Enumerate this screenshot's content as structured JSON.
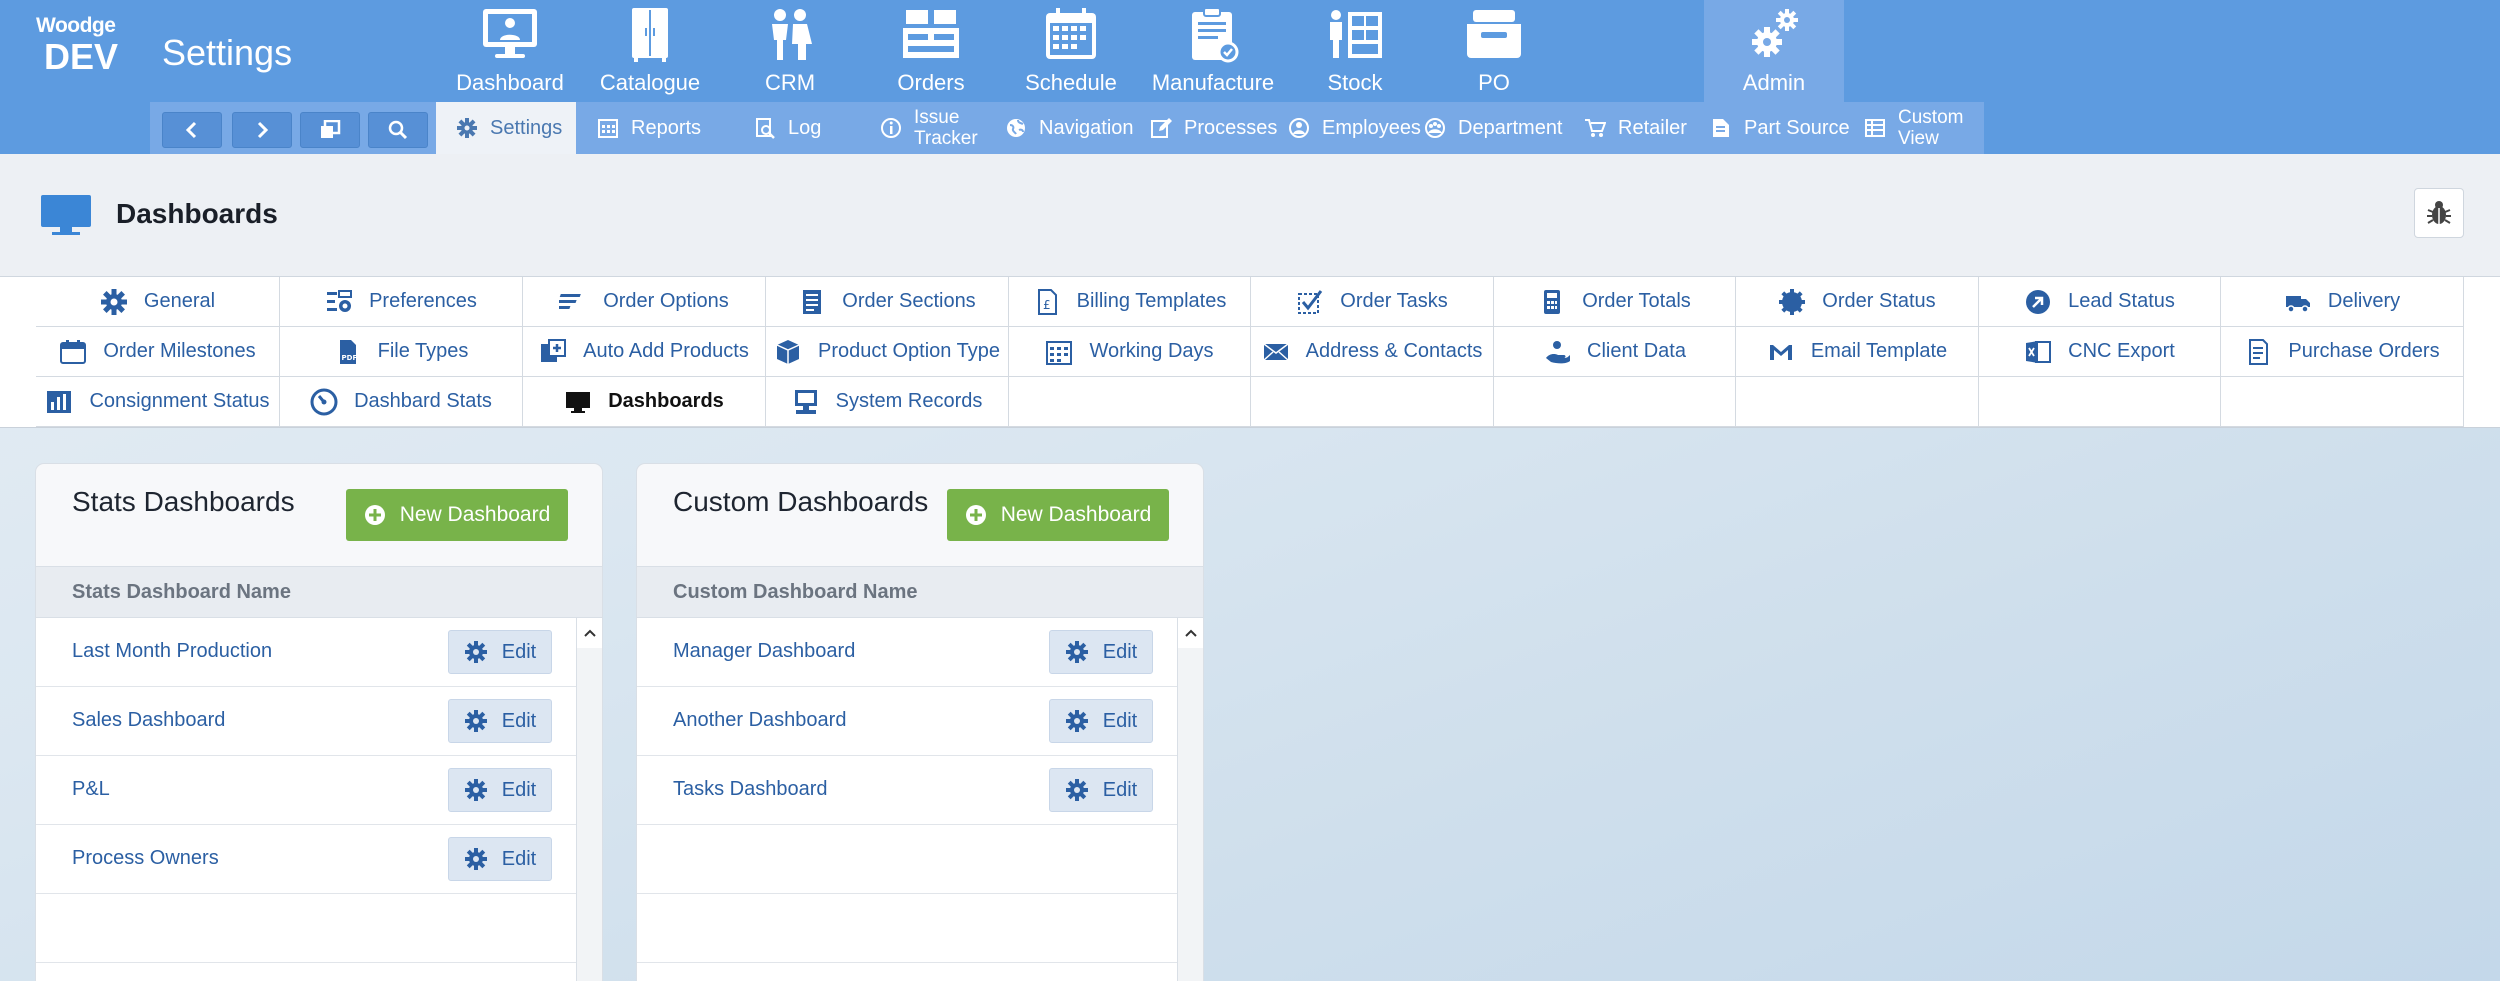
{
  "app": {
    "brand": "Woodge",
    "env": "DEV",
    "title": "Settings"
  },
  "modules": [
    {
      "label": "Dashboard",
      "icon": "monitor-person-icon"
    },
    {
      "label": "Catalogue",
      "icon": "wardrobe-icon"
    },
    {
      "label": "CRM",
      "icon": "people-icon"
    },
    {
      "label": "Orders",
      "icon": "orders-icon"
    },
    {
      "label": "Schedule",
      "icon": "calendar-icon"
    },
    {
      "label": "Manufacture",
      "icon": "clipboard-icon"
    },
    {
      "label": "Stock",
      "icon": "stock-icon"
    },
    {
      "label": "PO",
      "icon": "tray-icon"
    },
    {
      "label": "Admin",
      "icon": "gears-icon",
      "active": true
    }
  ],
  "subnav": [
    {
      "label": "Settings",
      "icon": "gear-icon",
      "active": true
    },
    {
      "label": "Reports",
      "icon": "calendar-grid-icon"
    },
    {
      "label": "Log",
      "icon": "search-doc-icon"
    },
    {
      "label": "Issue Tracker",
      "line1": "Issue",
      "line2": "Tracker",
      "icon": "info-icon"
    },
    {
      "label": "Navigation",
      "icon": "globe-icon"
    },
    {
      "label": "Processes",
      "icon": "pencil-icon"
    },
    {
      "label": "Employees",
      "icon": "person-circle-icon"
    },
    {
      "label": "Department",
      "icon": "group-circle-icon"
    },
    {
      "label": "Retailer",
      "icon": "cart-icon"
    },
    {
      "label": "Part Source",
      "icon": "tag-icon"
    },
    {
      "label": "Custom View",
      "line1": "Custom",
      "line2": "View",
      "icon": "table-icon"
    }
  ],
  "page": {
    "title": "Dashboards"
  },
  "settings_grid": [
    [
      "General",
      "Preferences",
      "Order Options",
      "Order Sections",
      "Billing Templates",
      "Order Tasks",
      "Order Totals",
      "Order Status",
      "Lead Status",
      "Delivery"
    ],
    [
      "Order Milestones",
      "File Types",
      "Auto Add Products",
      "Product Option Type",
      "Working Days",
      "Address & Contacts",
      "Client Data",
      "Email Template",
      "CNC Export",
      "Purchase Orders"
    ],
    [
      "Consignment Status",
      "Dashbard Stats",
      "Dashboards",
      "System Records",
      "",
      "",
      "",
      "",
      "",
      ""
    ]
  ],
  "stats_panel": {
    "title": "Stats Dashboards",
    "new_label": "New Dashboard",
    "column": "Stats Dashboard Name",
    "edit_label": "Edit",
    "rows": [
      "Last Month Production",
      "Sales Dashboard",
      "P&L",
      "Process Owners"
    ]
  },
  "custom_panel": {
    "title": "Custom Dashboards",
    "new_label": "New Dashboard",
    "column": "Custom Dashboard Name",
    "edit_label": "Edit",
    "rows": [
      "Manager Dashboard",
      "Another Dashboard",
      "Tasks Dashboard"
    ]
  },
  "colors": {
    "topbar": "#5d9be0",
    "subbar": "#78a9e6",
    "link": "#2b5fa3",
    "green": "#78b34a"
  }
}
